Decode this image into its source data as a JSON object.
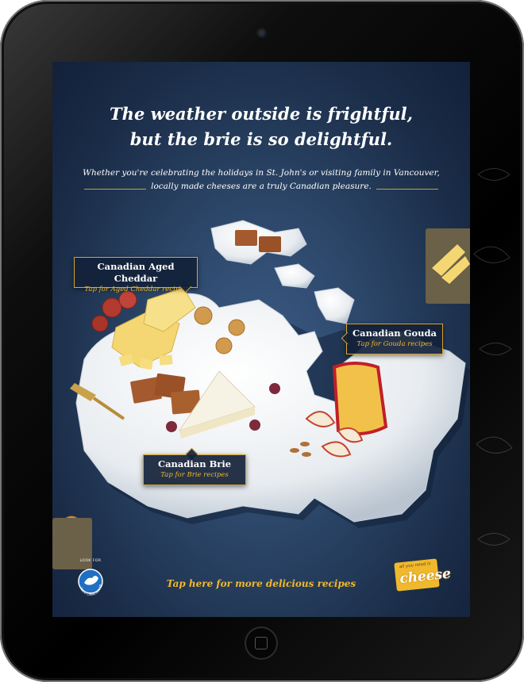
{
  "ad": {
    "headline_line1": "The weather outside is frightful,",
    "headline_line2": "but the brie is so delightful.",
    "subtext_line1": "Whether you're celebrating the holidays in St. John's or visiting family in Vancouver,",
    "subtext_line2": "locally made cheeses are a truly Canadian pleasure.",
    "callouts": [
      {
        "title": "Canadian Aged Cheddar",
        "link": "Tap for Aged Cheddar recipes"
      },
      {
        "title": "Canadian Gouda",
        "link": "Tap for Gouda recipes"
      },
      {
        "title": "Canadian Brie",
        "link": "Tap for Brie recipes"
      }
    ],
    "cta": "Tap here for more delicious recipes",
    "look_for_label": "LOOK FOR",
    "milk_logo_text": "100% CANADIAN MILK",
    "cheese_logo_small": "all you need is",
    "cheese_logo_big": "cheese"
  },
  "colors": {
    "accent_gold": "#d9a52b",
    "background_navy": "#1e3352",
    "bezel": "#000000"
  },
  "icons": {
    "home_button": "home-button-icon",
    "camera": "camera-icon"
  }
}
